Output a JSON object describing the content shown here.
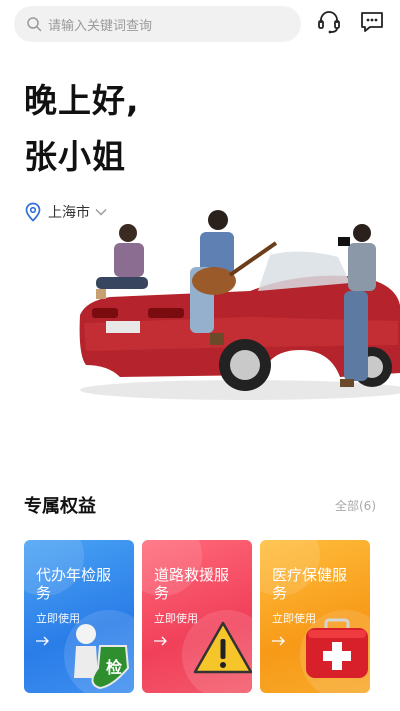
{
  "search": {
    "placeholder": "请输入关键词查询"
  },
  "icons": {
    "search": "search-icon",
    "service": "headset-icon",
    "message": "message-icon",
    "location": "location-pin-icon",
    "dropdown": "chevron-down-icon",
    "arrow": "arrow-right-icon"
  },
  "greeting": {
    "line1": "晚上好,",
    "line2": "张小姐"
  },
  "location": {
    "city": "上海市"
  },
  "benefits": {
    "title": "专属权益",
    "all_label": "全部(6)",
    "cards": [
      {
        "name": "代办年检服务",
        "use": "立即使用",
        "badge": "检",
        "color": "#2f82ec"
      },
      {
        "name": "道路救援服务",
        "use": "立即使用",
        "color": "#f2445c"
      },
      {
        "name": "医疗保健服务",
        "use": "立即使用",
        "color": "#f8a11f"
      }
    ]
  }
}
